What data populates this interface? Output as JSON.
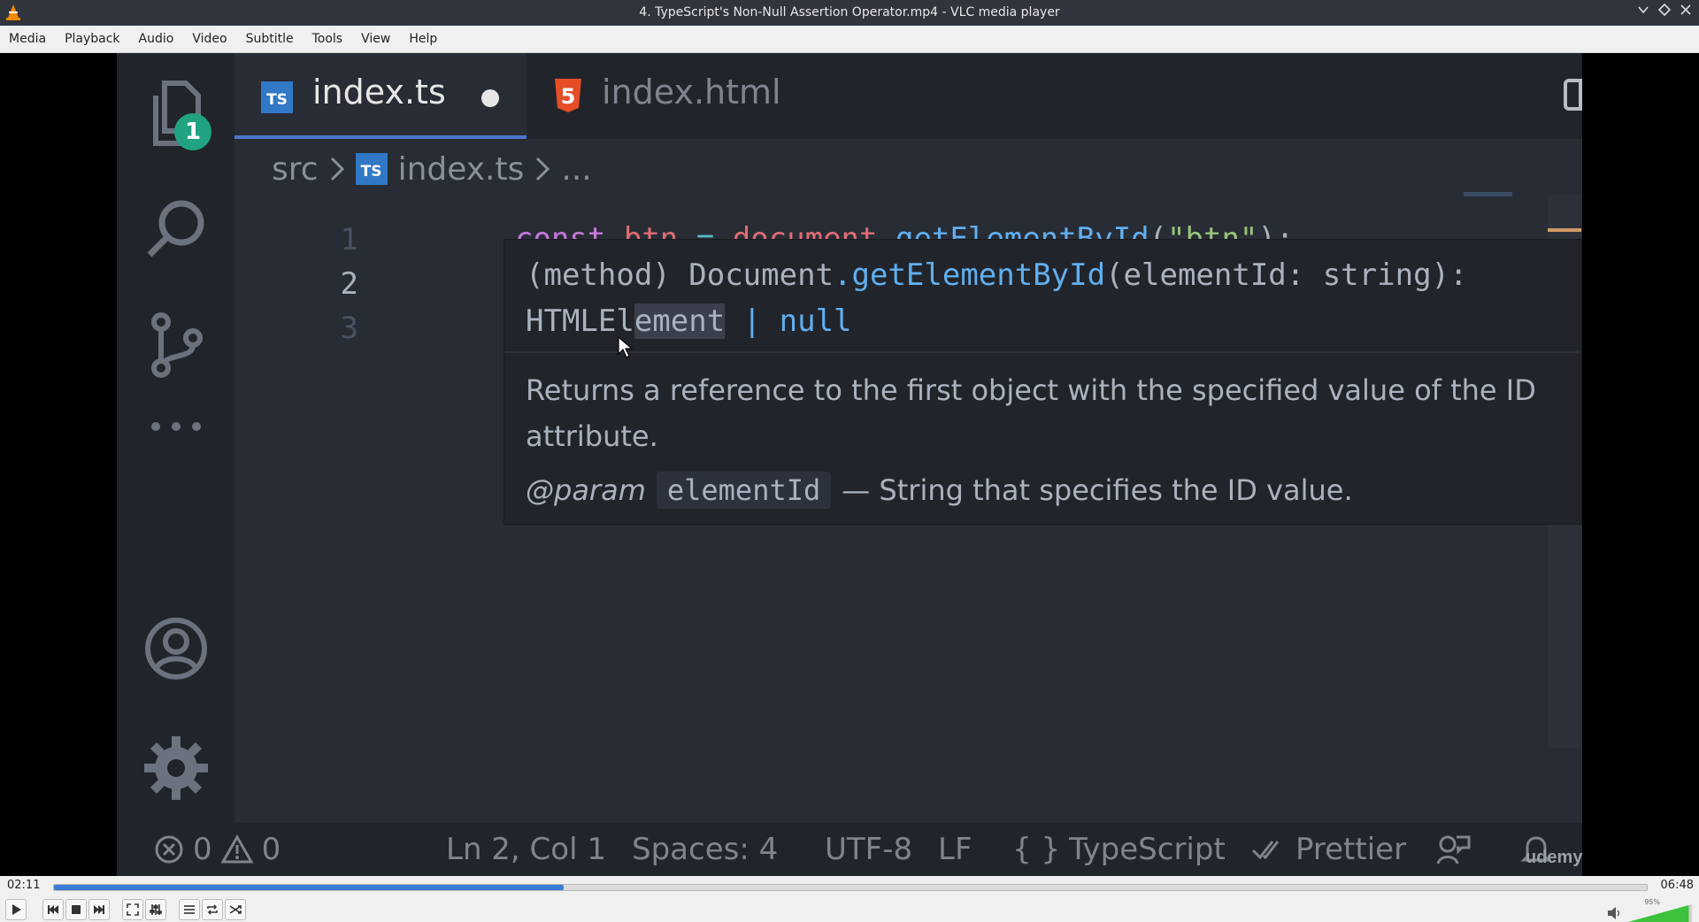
{
  "window": {
    "title": "4. TypeScript's Non-Null Assertion Operator.mp4 - VLC media player",
    "buttons": [
      "minimize",
      "restore",
      "close"
    ]
  },
  "menu": [
    "Media",
    "Playback",
    "Audio",
    "Video",
    "Subtitle",
    "Tools",
    "View",
    "Help"
  ],
  "video": {
    "activity_bar": {
      "explorer_badge": "1",
      "icons": [
        "files-icon",
        "search-icon",
        "source-control-icon",
        "more-icon",
        "account-icon",
        "settings-gear-icon"
      ]
    },
    "tabs": [
      {
        "icon": "TS",
        "label": "index.ts",
        "modified": true,
        "active": true
      },
      {
        "icon": "html5-icon",
        "label": "index.html",
        "active": false
      }
    ],
    "breadcrumb": {
      "folder": "src",
      "icon": "TS",
      "file": "index.ts",
      "more": "..."
    },
    "line_numbers": [
      "1",
      "2",
      "3"
    ],
    "code": {
      "kw": "const",
      "var": "btn",
      "op": "=",
      "obj": "document",
      "dot": ".",
      "fn": "getElementById",
      "paren_open": "(",
      "str": "\"btn\"",
      "tail": ");"
    },
    "hover": {
      "sig_method": "(method)",
      "sig_obj": "Document",
      "sig_dot": ".",
      "sig_fn": "getElementById",
      "sig_params": "(elementId: string):",
      "sig_ret_a": "HTMLEl",
      "sig_ret_b": "ement",
      "sig_pipe": "|",
      "sig_null": "null",
      "doc": "Returns a reference to the first object with the specified value of the ID attribute.",
      "param_tag": "@param",
      "param_name": "elementId",
      "param_desc": "— String that specifies the ID value."
    },
    "status": {
      "errors": "0",
      "warnings": "0",
      "position": "Ln 2, Col 1",
      "spaces": "Spaces: 4",
      "encoding": "UTF-8",
      "eol": "LF",
      "lang_braces": "{ }",
      "language": "TypeScript",
      "prettier": "Prettier",
      "watermark": "udemy"
    }
  },
  "player": {
    "elapsed": "02:11",
    "total": "06:48",
    "progress": 0.32,
    "volume_label": "95%",
    "volume": 0.95
  }
}
